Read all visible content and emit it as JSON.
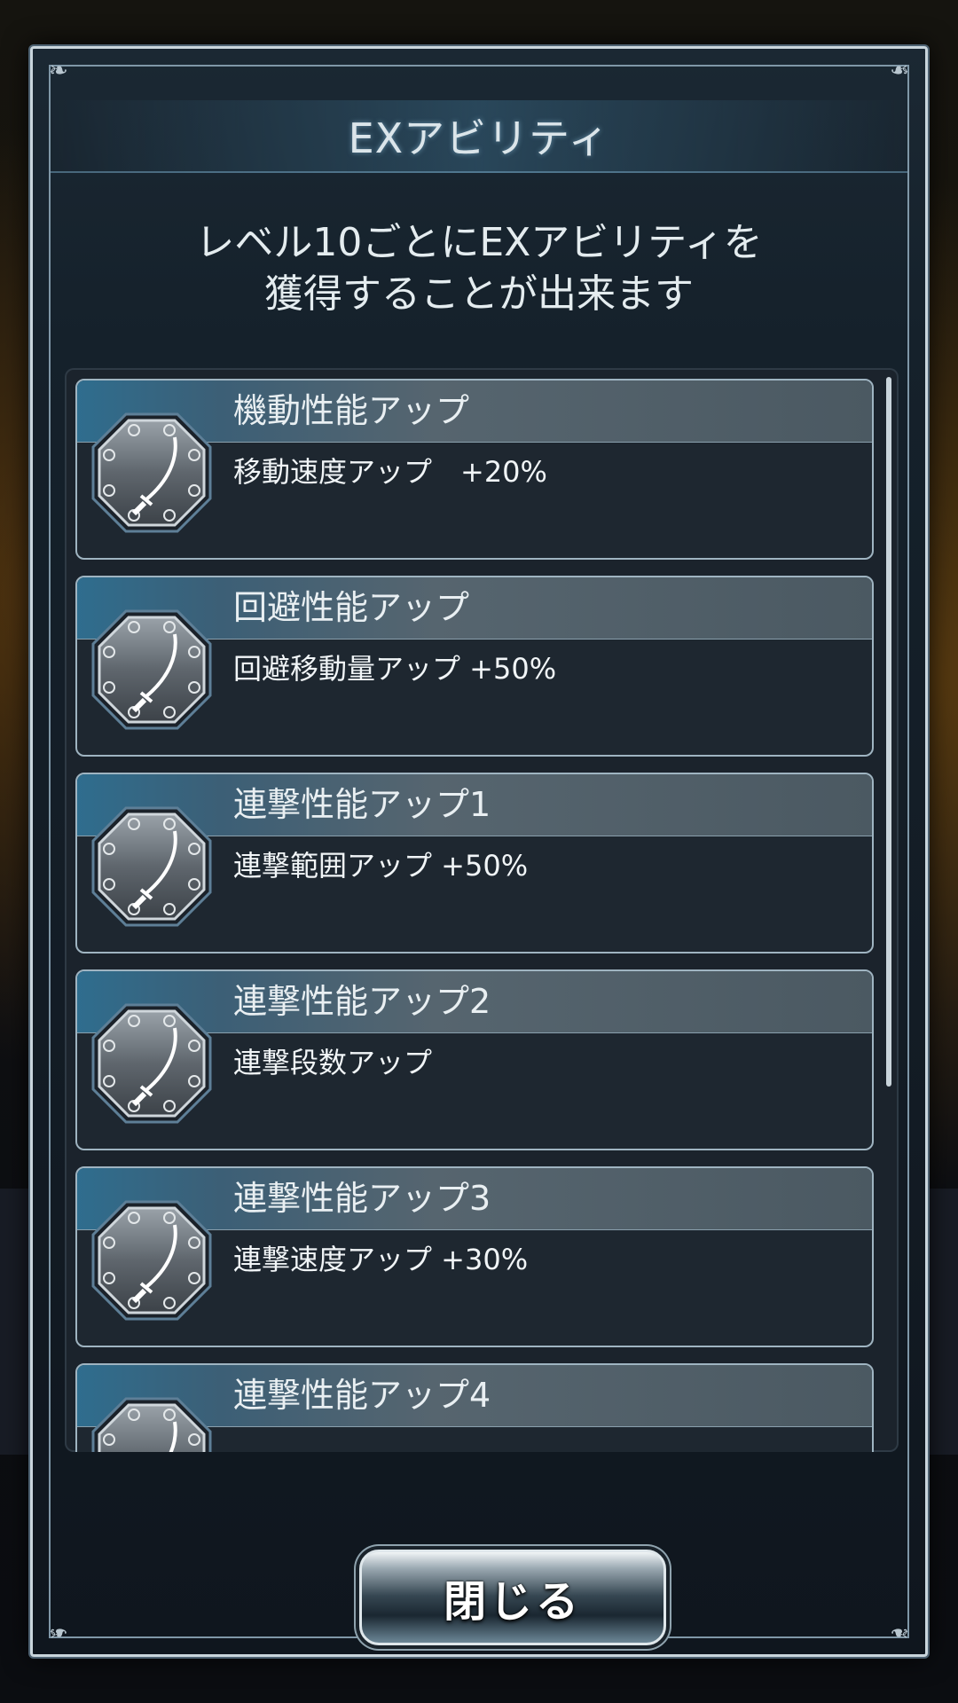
{
  "dialog": {
    "title": "EXアビリティ",
    "description_line1": "レベル10ごとにEXアビリティを",
    "description_line2": "獲得することが出来ます",
    "close_label": "閉じる"
  },
  "abilities": [
    {
      "title": "機動性能アップ",
      "desc": "移動速度アップ　+20%",
      "icon": "sword-icon"
    },
    {
      "title": "回避性能アップ",
      "desc": "回避移動量アップ +50%",
      "icon": "sword-icon"
    },
    {
      "title": "連撃性能アップ1",
      "desc": "連撃範囲アップ +50%",
      "icon": "sword-icon"
    },
    {
      "title": "連撃性能アップ2",
      "desc": "連撃段数アップ",
      "icon": "sword-icon"
    },
    {
      "title": "連撃性能アップ3",
      "desc": "連撃速度アップ +30%",
      "icon": "sword-icon"
    },
    {
      "title": "連撃性能アップ4",
      "desc": "",
      "icon": "sword-icon"
    }
  ],
  "colors": {
    "frame": "#c9d5dc",
    "item_header": "#3c5f76",
    "text": "#e9eff2"
  }
}
